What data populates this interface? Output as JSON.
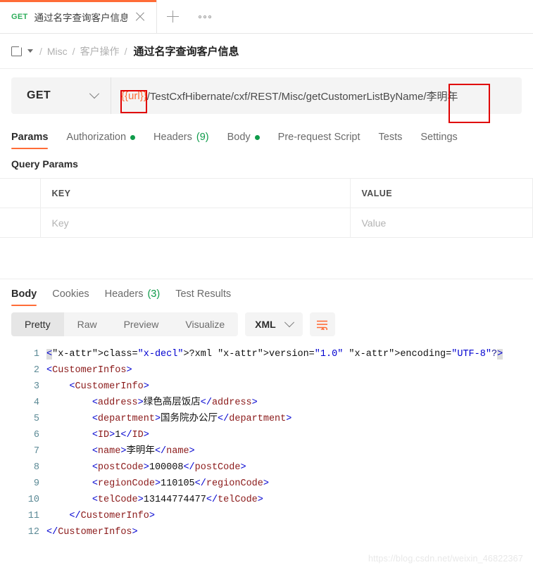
{
  "tabstrip": {
    "tab": {
      "method": "GET",
      "title": "通过名字查询客户信息",
      "close_icon": "close-icon"
    },
    "new_tab_icon": "plus-icon",
    "more_icon": "ellipsis-icon"
  },
  "breadcrumb": {
    "folder_icon": "folder-icon",
    "caret_icon": "chevron-down-icon",
    "sep": "/",
    "items": [
      "Misc",
      "客户操作"
    ],
    "current": "通过名字查询客户信息"
  },
  "urlbar": {
    "method": "GET",
    "method_caret_icon": "chevron-down-icon",
    "url_variable": "{{url}}",
    "url_path": "/TestCxfHibernate/cxf/REST/Misc/getCustomerListByName/李明年",
    "annotation_color": "#e00000"
  },
  "request_tabs": [
    {
      "label": "Params",
      "active": true,
      "dot": false,
      "count": ""
    },
    {
      "label": "Authorization",
      "active": false,
      "dot": true,
      "count": ""
    },
    {
      "label": "Headers",
      "active": false,
      "dot": false,
      "count": "(9)"
    },
    {
      "label": "Body",
      "active": false,
      "dot": true,
      "count": ""
    },
    {
      "label": "Pre-request Script",
      "active": false,
      "dot": false,
      "count": ""
    },
    {
      "label": "Tests",
      "active": false,
      "dot": false,
      "count": ""
    },
    {
      "label": "Settings",
      "active": false,
      "dot": false,
      "count": ""
    }
  ],
  "query_params": {
    "title": "Query Params",
    "headers": {
      "key": "KEY",
      "value": "VALUE"
    },
    "row": {
      "key_placeholder": "Key",
      "value_placeholder": "Value"
    }
  },
  "response_tabs": [
    {
      "label": "Body",
      "active": true,
      "count": ""
    },
    {
      "label": "Cookies",
      "active": false,
      "count": ""
    },
    {
      "label": "Headers",
      "active": false,
      "count": "(3)"
    },
    {
      "label": "Test Results",
      "active": false,
      "count": ""
    }
  ],
  "response_toolbar": {
    "view_modes": [
      "Pretty",
      "Raw",
      "Preview",
      "Visualize"
    ],
    "active_view": "Pretty",
    "format": "XML",
    "format_caret_icon": "chevron-down-icon",
    "wrap_icon": "wrap-lines-icon"
  },
  "response_body": {
    "language": "xml",
    "lines": [
      {
        "n": 1,
        "text": "<?xml version=\"1.0\" encoding=\"UTF-8\"?>"
      },
      {
        "n": 2,
        "text": "<CustomerInfos>"
      },
      {
        "n": 3,
        "text": "    <CustomerInfo>"
      },
      {
        "n": 4,
        "text": "        <address>绿色高层饭店</address>"
      },
      {
        "n": 5,
        "text": "        <department>国务院办公厅</department>"
      },
      {
        "n": 6,
        "text": "        <ID>1</ID>"
      },
      {
        "n": 7,
        "text": "        <name>李明年</name>"
      },
      {
        "n": 8,
        "text": "        <postCode>100008</postCode>"
      },
      {
        "n": 9,
        "text": "        <regionCode>110105</regionCode>"
      },
      {
        "n": 10,
        "text": "        <telCode>13144774477</telCode>"
      },
      {
        "n": 11,
        "text": "    </CustomerInfo>"
      },
      {
        "n": 12,
        "text": "</CustomerInfos>"
      }
    ]
  },
  "watermark": "https://blog.csdn.net/weixin_46822367",
  "colors": {
    "accent": "#ff6c37",
    "method_get": "#2eae5b",
    "status_dot": "#0f9b4a",
    "annotation": "#e00000"
  }
}
